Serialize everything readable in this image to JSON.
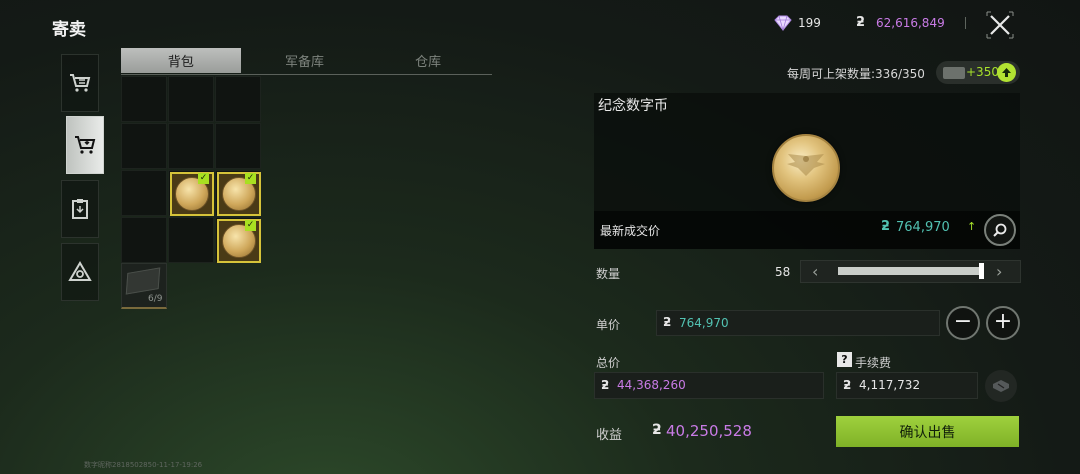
{
  "header": {
    "title": "寄卖"
  },
  "nav": {
    "items": [
      "cart-icon",
      "sell-cart-icon",
      "clipboard-icon",
      "delta-logo-icon"
    ],
    "active": 1
  },
  "tabs": {
    "items": [
      "背包",
      "军备库",
      "仓库"
    ],
    "active": 0
  },
  "inventory": {
    "item_count": "6/9"
  },
  "currency": {
    "gems": "199",
    "money": "62,616,849",
    "money_symbol": "ƻ"
  },
  "weekly": {
    "label": "每周可上架数量:336/350",
    "bonus": "+350"
  },
  "item": {
    "name": "纪念数字币",
    "latest_price_label": "最新成交价",
    "latest_price": "764,970",
    "trend": "↑"
  },
  "quantity": {
    "label": "数量",
    "value": "58",
    "fill_fraction": 1.0
  },
  "unit_price": {
    "label": "单价",
    "value": "764,970"
  },
  "total": {
    "label": "总价",
    "value": "44,368,260"
  },
  "fee": {
    "label": "手续费",
    "value": "4,117,732",
    "help": "?"
  },
  "income": {
    "label": "收益",
    "value": "40,250,528"
  },
  "actions": {
    "confirm": "确认出售",
    "minus": "−",
    "plus": "+"
  },
  "watermark": "数字昵称2818502850-11-17-19:26",
  "colors": {
    "accent_green": "#a7e22b",
    "price_teal": "#52c2b2",
    "money_purple": "#c97be6"
  }
}
